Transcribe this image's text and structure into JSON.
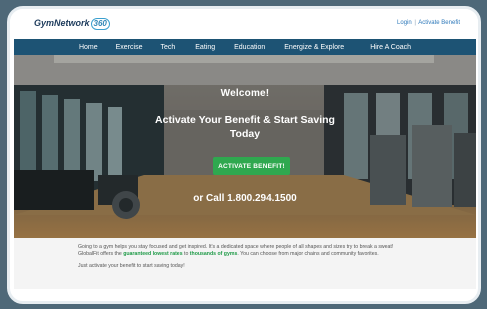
{
  "header": {
    "logo_text": "GymNetwork",
    "logo_number": "360",
    "login_label": "Login",
    "separator": "|",
    "activate_label": "Activate Benefit"
  },
  "nav": {
    "items": [
      "Home",
      "Exercise",
      "Tech",
      "Eating",
      "Education",
      "Energize & Explore",
      "Hire A Coach"
    ]
  },
  "hero": {
    "welcome": "Welcome!",
    "headline_line1": "Activate Your Benefit & Start Saving",
    "headline_line2": "Today",
    "button_label": "ACTIVATE BENEFIT!",
    "call_text": "or Call 1.800.294.1500"
  },
  "info": {
    "p1_part1": "Going to a gym helps you stay focused and get inspired. It's a dedicated space where people of all shapes and sizes try to break a sweat! GlobalFit offers the ",
    "p1_highlight1": "guaranteed lowest rates",
    "p1_part2": " to ",
    "p1_highlight2": "thousands of gyms",
    "p1_part3": ". You can choose from major chains and community favorites.",
    "p2": "Just activate your benefit to start saving today!"
  },
  "colors": {
    "nav_bg": "#1d5374",
    "button_bg": "#2fa84f",
    "accent_green": "#1e9a47",
    "link_blue": "#2e79ba",
    "outer_bg": "#4e6878"
  }
}
